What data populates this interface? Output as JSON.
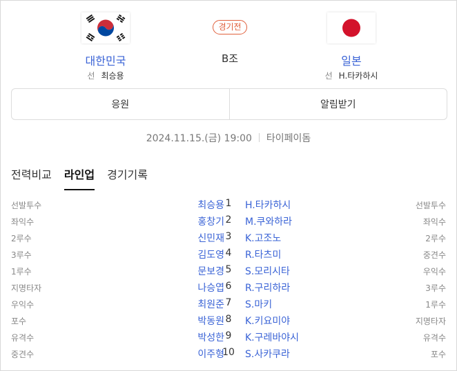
{
  "home": {
    "name": "대한민국",
    "pitcher_tag": "선",
    "pitcher": "최승용",
    "flag_icon": "south-korea-flag-icon"
  },
  "away": {
    "name": "일본",
    "pitcher_tag": "선",
    "pitcher": "H.타카하시",
    "flag_icon": "japan-flag-icon"
  },
  "match": {
    "badge": "경기전",
    "group": "B조",
    "date": "2024.11.15.(금) 19:00",
    "venue": "타이페이돔"
  },
  "buttons": {
    "cheer": "응원",
    "notify": "알림받기"
  },
  "tabs": [
    {
      "label": "전력비교",
      "active": false
    },
    {
      "label": "라인업",
      "active": true
    },
    {
      "label": "경기기록",
      "active": false
    }
  ],
  "lineup": [
    {
      "home_pos": "선발투수",
      "home_name": "최승용",
      "num": "1",
      "away_name": "H.타카하시",
      "away_pos": "선발투수"
    },
    {
      "home_pos": "좌익수",
      "home_name": "홍창기",
      "num": "2",
      "away_name": "M.쿠와하라",
      "away_pos": "좌익수"
    },
    {
      "home_pos": "2루수",
      "home_name": "신민재",
      "num": "3",
      "away_name": "K.고조노",
      "away_pos": "2루수"
    },
    {
      "home_pos": "3루수",
      "home_name": "김도영",
      "num": "4",
      "away_name": "R.타츠미",
      "away_pos": "중견수"
    },
    {
      "home_pos": "1루수",
      "home_name": "문보경",
      "num": "5",
      "away_name": "S.모리시타",
      "away_pos": "우익수"
    },
    {
      "home_pos": "지명타자",
      "home_name": "나승엽",
      "num": "6",
      "away_name": "R.구리하라",
      "away_pos": "3루수"
    },
    {
      "home_pos": "우익수",
      "home_name": "최원준",
      "num": "7",
      "away_name": "S.마키",
      "away_pos": "1루수"
    },
    {
      "home_pos": "포수",
      "home_name": "박동원",
      "num": "8",
      "away_name": "K.키요미야",
      "away_pos": "지명타자"
    },
    {
      "home_pos": "유격수",
      "home_name": "박성한",
      "num": "9",
      "away_name": "K.구레바야시",
      "away_pos": "유격수"
    },
    {
      "home_pos": "중견수",
      "home_name": "이주형",
      "num": "10",
      "away_name": "S.사카쿠라",
      "away_pos": "포수"
    }
  ],
  "colors": {
    "accent": "#3a63d6",
    "badge": "#e05f3b"
  }
}
